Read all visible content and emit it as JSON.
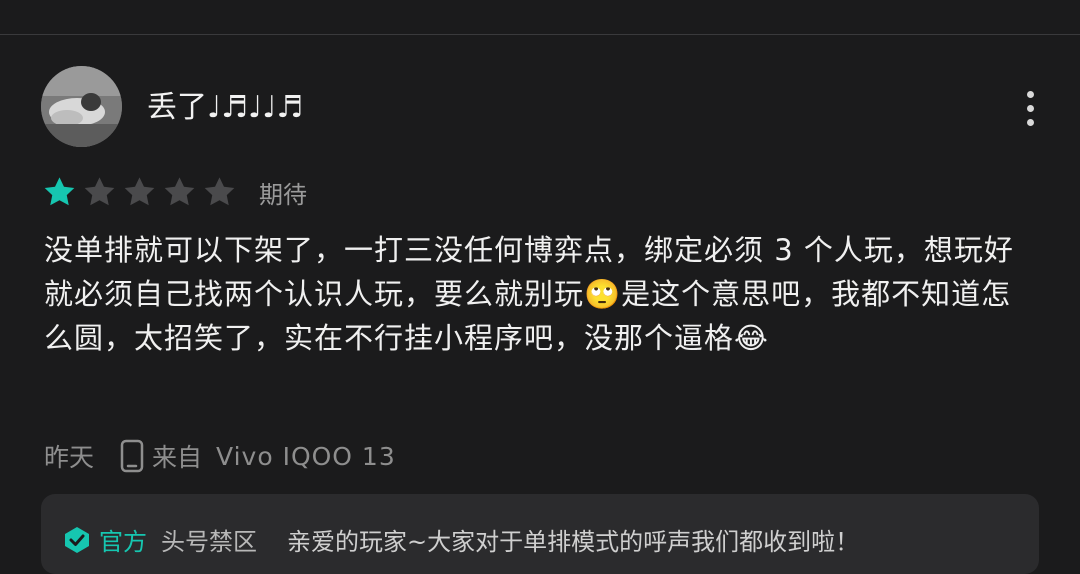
{
  "review": {
    "username": "丢了♩♬♩♩♬",
    "rating": 1,
    "rating_max": 5,
    "rating_label": "期待",
    "text": "没单排就可以下架了，一打三没任何博弈点，绑定必须 3 个人玩，想玩好就必须自己找两个认识人玩，要么就别玩🙄是这个意思吧，我都不知道怎么圆，太招笑了，实在不行挂小程序吧，没那个逼格😂",
    "time": "昨天",
    "device_prefix": "来自",
    "device": "Vivo IQOO 13"
  },
  "reply": {
    "official_label": "官方",
    "author": "头号禁区",
    "text": "亲爱的玩家~大家对于单排模式的呼声我们都收到啦！"
  },
  "colors": {
    "background": "#1b1b1c",
    "star_active": "#16c6b0",
    "star_inactive": "#4a4a4c",
    "official_accent": "#16c6b0"
  },
  "icons": {
    "more": "more-vertical-icon",
    "star": "star-icon",
    "phone": "phone-icon",
    "official": "official-badge-icon"
  }
}
